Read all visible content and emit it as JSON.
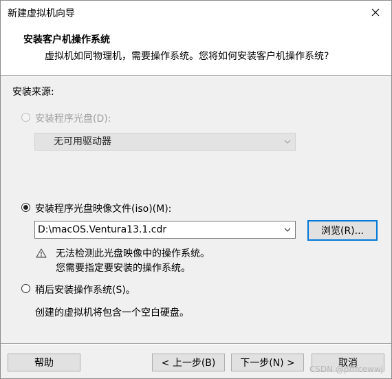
{
  "window": {
    "title": "新建虚拟机向导"
  },
  "header": {
    "title": "安装客户机操作系统",
    "description": "虚拟机如同物理机，需要操作系统。您将如何安装客户机操作系统?"
  },
  "source": {
    "label": "安装来源:",
    "disc_option": {
      "label": "安装程序光盘(D):",
      "selected": false,
      "enabled": false
    },
    "drive_select": {
      "value": "无可用驱动器"
    },
    "iso_option": {
      "label": "安装程序光盘映像文件(iso)(M):",
      "selected": true
    },
    "iso_path": {
      "value": "D:\\macOS.Ventura13.1.cdr"
    },
    "browse_label": "浏览(R)...",
    "warning_line1": "无法检测此光盘映像中的操作系统。",
    "warning_line2": "您需要指定要安装的操作系统。",
    "later_option": {
      "label": "稍后安装操作系统(S)。",
      "selected": false
    },
    "later_desc": "创建的虚拟机将包含一个空白硬盘。"
  },
  "footer": {
    "help_label": "帮助",
    "back_label": "< 上一步(B)",
    "next_label": "下一步(N) >",
    "cancel_label": "取消"
  },
  "watermark": "CSDN @pfffcewwj",
  "icons": {
    "close": "close-icon",
    "warning": "warning-icon",
    "dropdown": "chevron-down-icon"
  }
}
